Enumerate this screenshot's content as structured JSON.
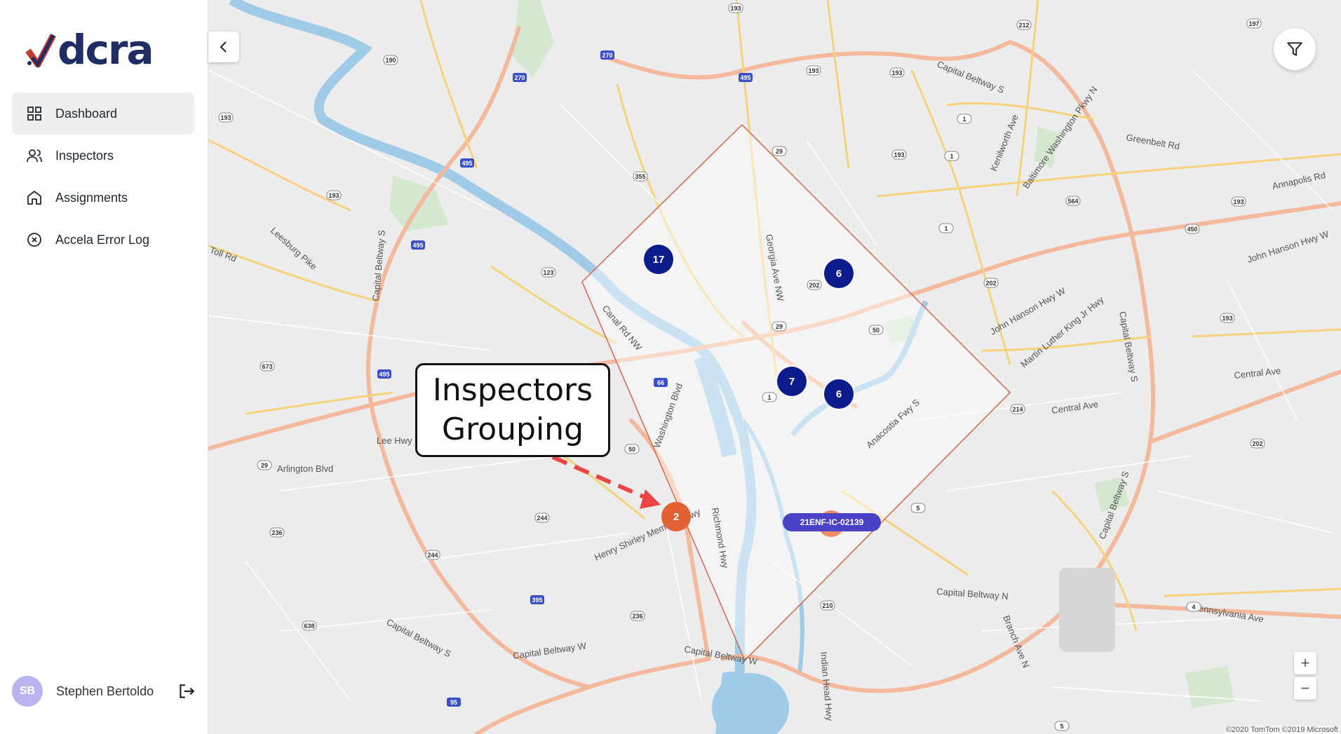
{
  "sidebar": {
    "logo_text": "dcra",
    "nav": [
      {
        "label": "Dashboard",
        "icon": "dashboard-grid-icon",
        "active": true
      },
      {
        "label": "Inspectors",
        "icon": "users-icon",
        "active": false
      },
      {
        "label": "Assignments",
        "icon": "home-icon",
        "active": false
      },
      {
        "label": "Accela Error Log",
        "icon": "x-circle-icon",
        "active": false
      }
    ],
    "user": {
      "initials": "SB",
      "name": "Stephen Bertoldo"
    }
  },
  "map": {
    "clusters": [
      {
        "count": "17",
        "color": "#0d1c8c"
      },
      {
        "count": "6",
        "color": "#0d1c8c"
      },
      {
        "count": "7",
        "color": "#0d1c8c"
      },
      {
        "count": "6",
        "color": "#0d1c8c"
      },
      {
        "count": "2",
        "color": "#e46035"
      }
    ],
    "selected_label": "21ENF-IC-02139",
    "callout": {
      "line1": "Inspectors",
      "line2": "Grouping"
    },
    "zoom_in": "+",
    "zoom_out": "−",
    "attribution": "©2020 TomTom ©2019 Microsoft",
    "road_labels": [
      "Capital Beltway S",
      "Greenbelt Rd",
      "Annapolis Rd",
      "John Hanson Hwy W",
      "John Hanson Hwy W",
      "Central Ave",
      "Central Ave",
      "Pennsylvania Ave",
      "Capital Beltway N",
      "Capital Beltway W",
      "Capital Beltway W",
      "Capital Beltway S",
      "Arlington Blvd",
      "Lee Hwy",
      "Leesburg Pike",
      "Toll Rd",
      "Canal Rd NW",
      "Georgia Ave NW",
      "Anacostia Fwy S",
      "Washington Blvd",
      "Richmond Hwy",
      "Henry Shirley Memorial Hwy",
      "Indian Head Hwy",
      "Branch Ave N",
      "Kenilworth Ave",
      "Baltimore Washington Pkwy N",
      "Martin Luther King Jr Hwy",
      "Capital Beltway S",
      "Capital Beltway S",
      "Capital Beltway S"
    ],
    "route_shields": [
      "190",
      "193",
      "270",
      "270",
      "495",
      "495",
      "495",
      "495",
      "66",
      "395",
      "95",
      "193",
      "193",
      "355",
      "193",
      "123",
      "673",
      "29",
      "50",
      "244",
      "244",
      "236",
      "236",
      "638",
      "212",
      "197",
      "193",
      "1",
      "1",
      "1",
      "564",
      "193",
      "450",
      "202",
      "202",
      "193",
      "50",
      "29",
      "1",
      "5",
      "210",
      "214",
      "4",
      "5",
      "202",
      "193",
      "29"
    ]
  }
}
